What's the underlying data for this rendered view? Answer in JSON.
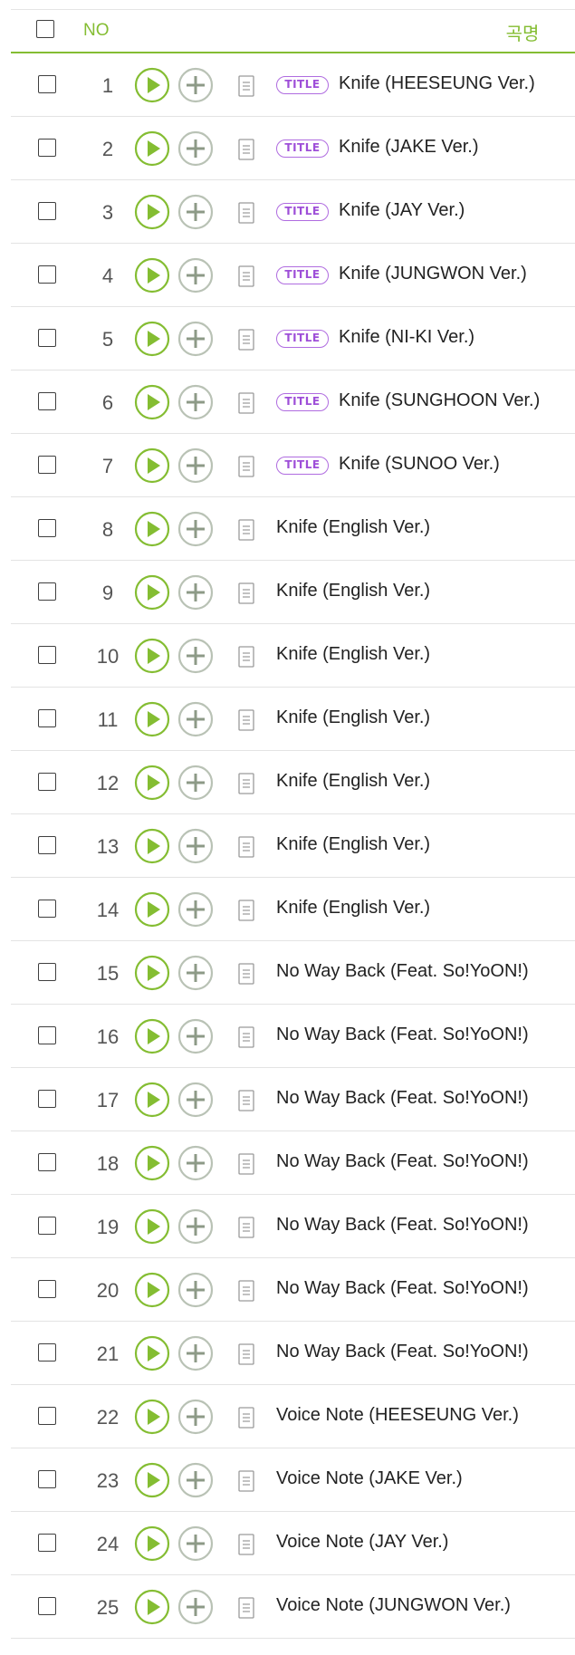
{
  "header": {
    "no_label": "NO",
    "title_label": "곡명"
  },
  "colors": {
    "accent": "#84bd32",
    "title_badge": "#9e4fd8",
    "add_icon": "#8d9a87"
  },
  "icons": {
    "play": "play-icon",
    "add": "plus-icon",
    "lyrics": "document-icon",
    "checkbox": "checkbox-icon"
  },
  "tracks": [
    {
      "no": "1",
      "title": "Knife (HEESEUNG Ver.)",
      "badge": "TITLE"
    },
    {
      "no": "2",
      "title": "Knife (JAKE Ver.)",
      "badge": "TITLE"
    },
    {
      "no": "3",
      "title": "Knife (JAY Ver.)",
      "badge": "TITLE"
    },
    {
      "no": "4",
      "title": "Knife (JUNGWON Ver.)",
      "badge": "TITLE"
    },
    {
      "no": "5",
      "title": "Knife (NI-KI Ver.)",
      "badge": "TITLE"
    },
    {
      "no": "6",
      "title": "Knife (SUNGHOON Ver.)",
      "badge": "TITLE"
    },
    {
      "no": "7",
      "title": "Knife (SUNOO Ver.)",
      "badge": "TITLE"
    },
    {
      "no": "8",
      "title": "Knife (English Ver.)",
      "badge": ""
    },
    {
      "no": "9",
      "title": "Knife (English Ver.)",
      "badge": ""
    },
    {
      "no": "10",
      "title": "Knife (English Ver.)",
      "badge": ""
    },
    {
      "no": "11",
      "title": "Knife (English Ver.)",
      "badge": ""
    },
    {
      "no": "12",
      "title": "Knife (English Ver.)",
      "badge": ""
    },
    {
      "no": "13",
      "title": "Knife (English Ver.)",
      "badge": ""
    },
    {
      "no": "14",
      "title": "Knife (English Ver.)",
      "badge": ""
    },
    {
      "no": "15",
      "title": "No Way Back (Feat. So!YoON!)",
      "badge": ""
    },
    {
      "no": "16",
      "title": "No Way Back (Feat. So!YoON!)",
      "badge": ""
    },
    {
      "no": "17",
      "title": "No Way Back (Feat. So!YoON!)",
      "badge": ""
    },
    {
      "no": "18",
      "title": "No Way Back (Feat. So!YoON!)",
      "badge": ""
    },
    {
      "no": "19",
      "title": "No Way Back (Feat. So!YoON!)",
      "badge": ""
    },
    {
      "no": "20",
      "title": "No Way Back (Feat. So!YoON!)",
      "badge": ""
    },
    {
      "no": "21",
      "title": "No Way Back (Feat. So!YoON!)",
      "badge": ""
    },
    {
      "no": "22",
      "title": "Voice Note (HEESEUNG Ver.)",
      "badge": ""
    },
    {
      "no": "23",
      "title": "Voice Note (JAKE Ver.)",
      "badge": ""
    },
    {
      "no": "24",
      "title": "Voice Note (JAY Ver.)",
      "badge": ""
    },
    {
      "no": "25",
      "title": "Voice Note (JUNGWON Ver.)",
      "badge": ""
    }
  ]
}
